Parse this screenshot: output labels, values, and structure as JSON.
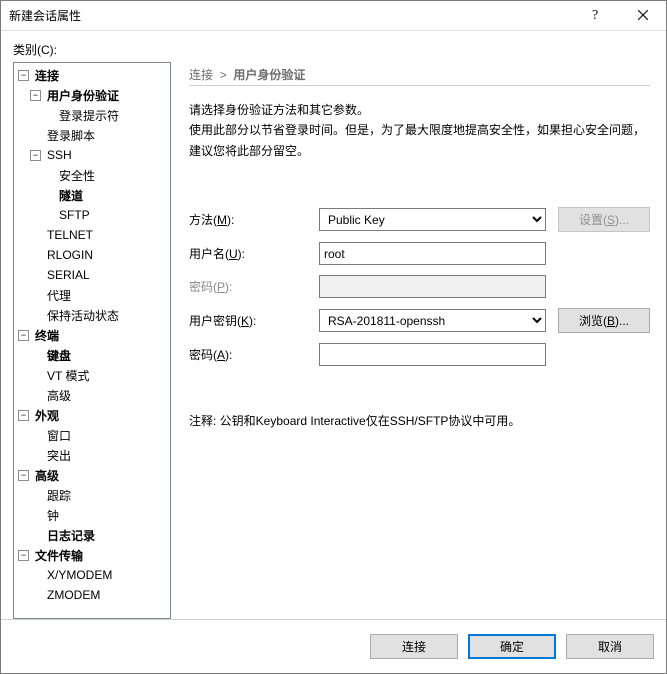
{
  "window": {
    "title": "新建会话属性"
  },
  "tree_category_label": "类别(C):",
  "tree": {
    "connection": {
      "label": "连接",
      "user_auth": {
        "label": "用户身份验证",
        "login_prompt": {
          "label": "登录提示符"
        }
      },
      "login_script": {
        "label": "登录脚本"
      },
      "ssh": {
        "label": "SSH",
        "security": {
          "label": "安全性"
        },
        "tunnel": {
          "label": "隧道"
        },
        "sftp": {
          "label": "SFTP"
        }
      },
      "telnet": {
        "label": "TELNET"
      },
      "rlogin": {
        "label": "RLOGIN"
      },
      "serial": {
        "label": "SERIAL"
      },
      "proxy": {
        "label": "代理"
      },
      "keepalive": {
        "label": "保持活动状态"
      }
    },
    "terminal": {
      "label": "终端",
      "keyboard": {
        "label": "键盘"
      },
      "vtmode": {
        "label": "VT 模式"
      },
      "advanced": {
        "label": "高级"
      }
    },
    "appearance": {
      "label": "外观",
      "window": {
        "label": "窗口"
      },
      "highlight": {
        "label": "突出"
      }
    },
    "advanced": {
      "label": "高级",
      "trace": {
        "label": "跟踪"
      },
      "bell": {
        "label": "钟"
      },
      "logging": {
        "label": "日志记录"
      }
    },
    "filetransfer": {
      "label": "文件传输",
      "xymodem": {
        "label": "X/YMODEM"
      },
      "zmodem": {
        "label": "ZMODEM"
      }
    }
  },
  "breadcrumb": {
    "root": "连接",
    "sep": ">",
    "page": "用户身份验证"
  },
  "description": {
    "line1": "请选择身份验证方法和其它参数。",
    "line2": "使用此部分以节省登录时间。但是，为了最大限度地提高安全性，如果担心安全问题，建议您将此部分留空。"
  },
  "form": {
    "method": {
      "label_text": "方法(",
      "label_key": "M",
      "label_suffix": "):",
      "value": "Public Key"
    },
    "username": {
      "label_text": "用户名(",
      "label_key": "U",
      "label_suffix": "):",
      "value": "root"
    },
    "password": {
      "label_text": "密码(",
      "label_key": "P",
      "label_suffix": "):",
      "value": ""
    },
    "userkey": {
      "label_text": "用户密钥(",
      "label_key": "K",
      "label_suffix": "):",
      "value": "RSA-201811-openssh"
    },
    "passphrase": {
      "label_text": "密码(",
      "label_key": "A",
      "label_suffix": "):",
      "value": ""
    }
  },
  "buttons": {
    "settings_text": "设置(",
    "settings_key": "S",
    "settings_suffix": ")...",
    "browse_text": "浏览(",
    "browse_key": "B",
    "browse_suffix": ")..."
  },
  "note": "注释: 公钥和Keyboard Interactive仅在SSH/SFTP协议中可用。",
  "footer": {
    "connect": "连接",
    "ok": "确定",
    "cancel": "取消"
  }
}
